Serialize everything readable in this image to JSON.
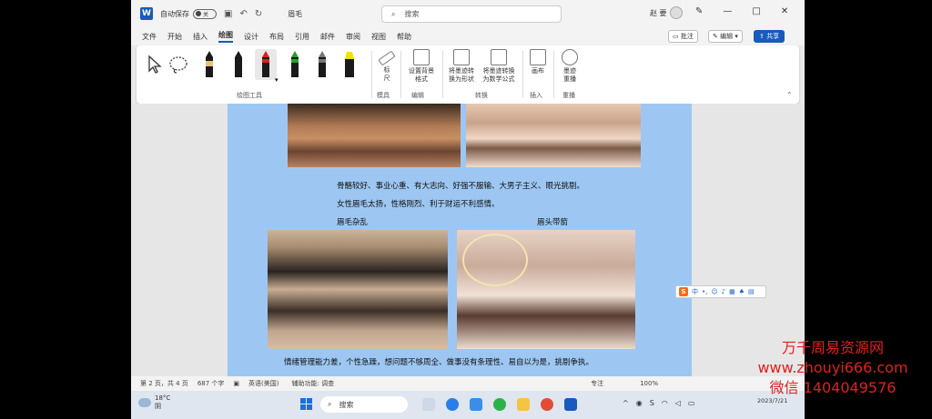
{
  "titlebar": {
    "autosave_label": "自动保存",
    "autosave_state": "关",
    "doc_name": "眉毛",
    "search_placeholder": "搜索",
    "user": "赵 要"
  },
  "menu": {
    "items": [
      "文件",
      "开始",
      "插入",
      "绘图",
      "设计",
      "布局",
      "引用",
      "邮件",
      "审阅",
      "视图",
      "帮助"
    ],
    "active": "绘图",
    "comment": "批注",
    "edit": "编辑",
    "share": "共享"
  },
  "ribbon": {
    "drawing_tools_label": "绘图工具",
    "ruler_label": "标尺",
    "ruler_group": "模具",
    "bg_format_label": "设置背景格式",
    "edit_group": "编辑",
    "ink_to_shape": "将墨迹转换为形状",
    "ink_to_math": "将墨迹转换为数学公式",
    "convert_group": "转换",
    "canvas_label": "画布",
    "insert_group": "插入",
    "replay_label": "墨迹重播",
    "replay_group": "重播",
    "pen_colors": [
      "#1a1a1a",
      "#1a1a1a",
      "#d62020",
      "#2aa02a",
      "#555555",
      "#f2e200"
    ]
  },
  "document": {
    "line1": "骨骼较好、事业心重、有大志向、好强不服输、大男子主义、眼光挑剔。",
    "line2": "女性眉毛太扬，性格刚烈、利于财运不利感情。",
    "caption_left": "眉毛杂乱",
    "caption_right": "眉头带箭",
    "line3": "情绪管理能力差，个性急躁，想问题不够周全、做事没有条理性、易自以为是，挑剔争执。"
  },
  "statusbar": {
    "page": "第 2 页，共 4 页",
    "words": "687 个字",
    "lang": "英语(美国)",
    "accessibility": "辅助功能: 调查",
    "focus": "专注",
    "zoom": "100%"
  },
  "taskbar": {
    "temp": "18°C",
    "weather": "阴",
    "search": "搜索",
    "date": "2023/7/21"
  },
  "watermark": {
    "line1": "万千周易资源网",
    "line2": "www.zhouyi666.com",
    "line3": "微信 1404049576"
  }
}
